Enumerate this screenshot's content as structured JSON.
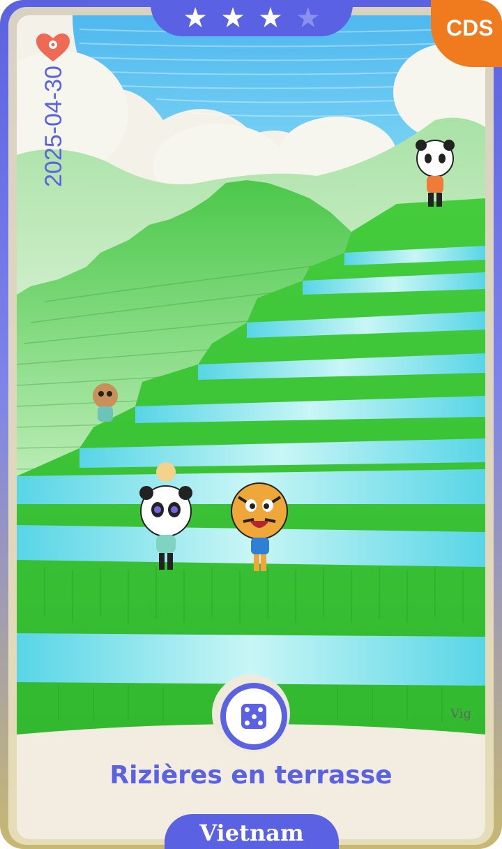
{
  "card": {
    "title": "Rizières en terrasse",
    "country": "Vietnam",
    "date": "2025-04-30",
    "badge": "CDS",
    "signature": "Vig",
    "rating": {
      "filled": 3,
      "total": 4
    }
  },
  "icons": {
    "favorite": "heart-location-icon",
    "roll": "dice-icon",
    "star": "star-icon"
  },
  "colors": {
    "primary": "#5a61e2",
    "badge": "#f07a1e",
    "grass": "#3dc53a",
    "water": "#6ee0ec",
    "sky": "#5ec6ef"
  }
}
